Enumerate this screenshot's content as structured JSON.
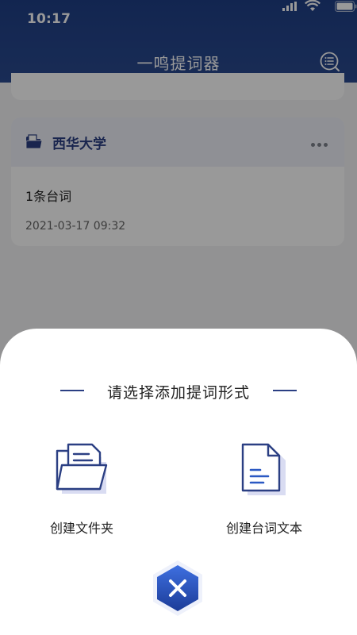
{
  "status_bar": {
    "time": "10:17"
  },
  "header": {
    "title": "一鸣提词器"
  },
  "folder_card": {
    "name": "西华大学",
    "script_count": "1条台词",
    "date": "2021-03-17 09:32"
  },
  "sheet": {
    "title": "请选择添加提词形式",
    "options": [
      {
        "label": "创建文件夹",
        "icon": "folder-icon"
      },
      {
        "label": "创建台词文本",
        "icon": "document-icon"
      }
    ]
  },
  "colors": {
    "brand": "#2b3f83",
    "header_top": "#1f3f86",
    "accent_blue": "#2b59c3",
    "icon_shadow": "#d9dcf2"
  }
}
